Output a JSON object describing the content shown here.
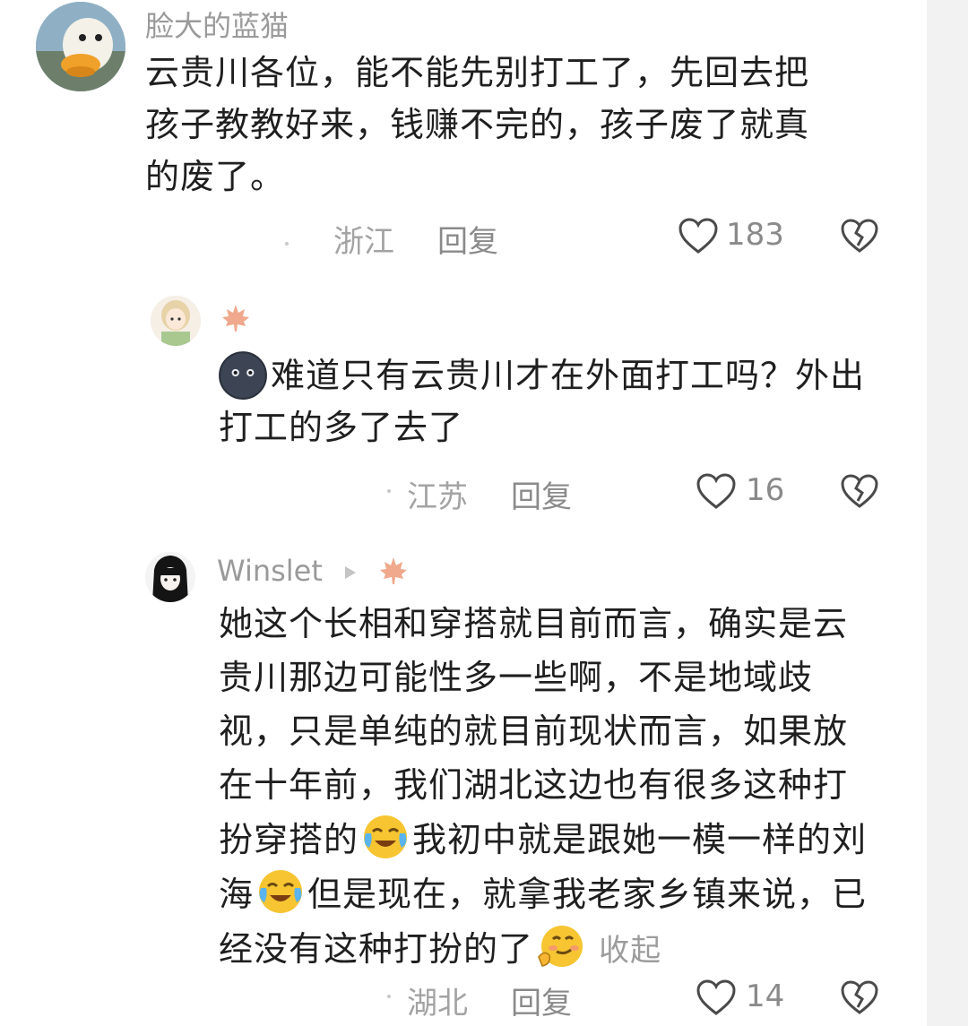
{
  "comments": [
    {
      "username": "脸大的蓝猫",
      "text_lines": [
        "云贵川各位，能不能先别打工了，先回去把",
        "孩子教教好来，钱赚不完的，孩子废了就真",
        "的废了。"
      ],
      "location": "浙江",
      "reply_label": "回复",
      "likes": "183"
    },
    {
      "username": "",
      "text_line1": "难道只有云贵川才在外面打工吗？外出",
      "text_line2": "打工的多了去了",
      "location": "江苏",
      "reply_label": "回复",
      "likes": "16"
    },
    {
      "username": "Winslet",
      "text_lines_a": [
        "她这个长相和穿搭就目前而言，确实是云",
        "贵川那边可能性多一些啊，不是地域歧",
        "视，只是单纯的就目前现状而言，如果放",
        "在十年前，我们湖北这边也有很多这种打"
      ],
      "line5_a": "扮穿搭的",
      "line5_b": "我初中就是跟她一模一样的刘",
      "line6_a": "海",
      "line6_b": "但是现在，就拿我老家乡镇来说，已",
      "line7_a": "经没有这种打扮的了",
      "collapse_label": "收起",
      "location": "湖北",
      "reply_label": "回复",
      "likes": "14"
    }
  ],
  "icons": {
    "like": "heart-outline-icon",
    "dislike": "broken-heart-icon",
    "badge": "maple-leaf-icon",
    "play": "play-triangle-icon",
    "emoji_cry_laugh": "crying-laughing-emoji-icon",
    "emoji_shy": "smirk-shy-emoji-icon",
    "dark_face": "dark-blob-emoji-icon"
  },
  "colors": {
    "text": "#1f1f1f",
    "meta": "#a3a3a3",
    "badge": "#e8704a"
  }
}
